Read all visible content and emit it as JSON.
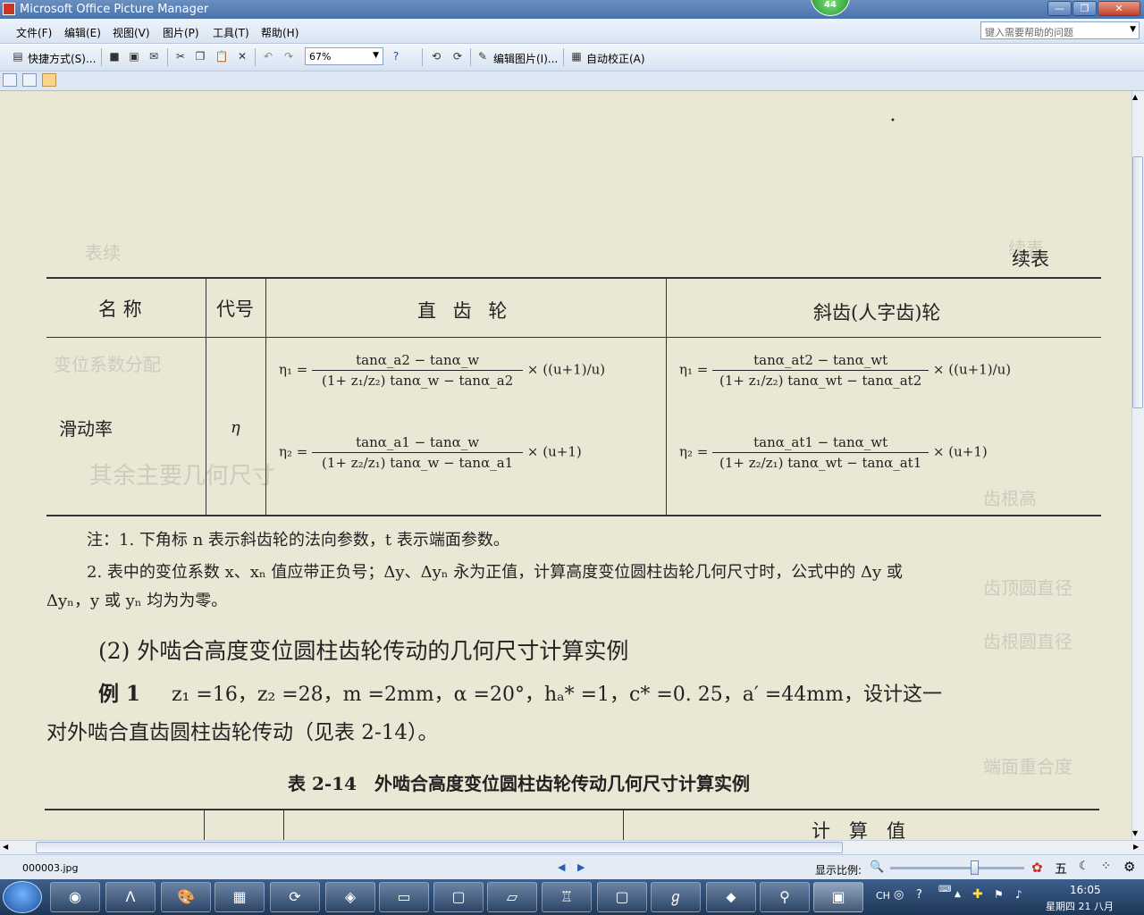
{
  "window": {
    "title": "Microsoft Office Picture Manager",
    "badge": "44",
    "controls": {
      "min": "—",
      "max": "❐",
      "close": "✕"
    }
  },
  "menu": [
    "文件(F)",
    "编辑(E)",
    "视图(V)",
    "图片(P)",
    "工具(T)",
    "帮助(H)"
  ],
  "help_search_placeholder": "键入需要帮助的问题",
  "toolbar": {
    "shortcuts": "快捷方式(S)...",
    "zoom": "67%",
    "edit_picture": "编辑图片(I)...",
    "auto_correct": "自动校正(A)"
  },
  "document": {
    "continued": "续表",
    "headers": {
      "name": "名 称",
      "symbol": "代号",
      "spur": "直 齿 轮",
      "helical": "斜齿(人字齿)轮"
    },
    "row": {
      "name": "滑动率",
      "symbol": "η"
    },
    "formulas": {
      "spur1": {
        "lhs": "η₁ =",
        "num": "tanα_a2 − tanα_w",
        "den": "(1+ z₁/z₂) tanα_w − tanα_a2",
        "tail": "× ((u+1)/u)"
      },
      "spur2": {
        "lhs": "η₂ =",
        "num": "tanα_a1 − tanα_w",
        "den": "(1+ z₂/z₁) tanα_w − tanα_a1",
        "tail": "× (u+1)"
      },
      "helical1": {
        "lhs": "η₁ =",
        "num": "tanα_at2 − tanα_wt",
        "den": "(1+ z₁/z₂) tanα_wt − tanα_at2",
        "tail": "× ((u+1)/u)"
      },
      "helical2": {
        "lhs": "η₂ =",
        "num": "tanα_at1 − tanα_wt",
        "den": "(1+ z₂/z₁) tanα_wt − tanα_at1",
        "tail": "× (u+1)"
      }
    },
    "note1": "注：1. 下角标 n 表示斜齿轮的法向参数，t 表示端面参数。",
    "note2a": "2. 表中的变位系数 x、xₙ 值应带正负号；Δy、Δyₙ 永为正值，计算高度变位圆柱齿轮几何尺寸时，公式中的 Δy 或",
    "note2b": "Δyₙ，y 或 yₙ 均为为零。",
    "section": "(2) 外啮合高度变位圆柱齿轮传动的几何尺寸计算实例",
    "example_label": "例 1",
    "example_text": "z₁ =16，z₂ =28，m =2mm，α =20°，hₐ* =1，c* =0. 25，a′ =44mm，设计这一",
    "example_text2": "对外啮合直齿圆柱齿轮传动（见表 2-14）。",
    "table_caption": "表 2-14　外啮合高度变位圆柱齿轮传动几何尺寸计算实例",
    "partial_header": "计　算　值"
  },
  "status": {
    "filename": "000003.jpg",
    "zoom_label": "显示比例:"
  },
  "tray": {
    "lang": "CH",
    "time": "16:05",
    "date": "星期四 21 八月",
    "ime": "五"
  }
}
